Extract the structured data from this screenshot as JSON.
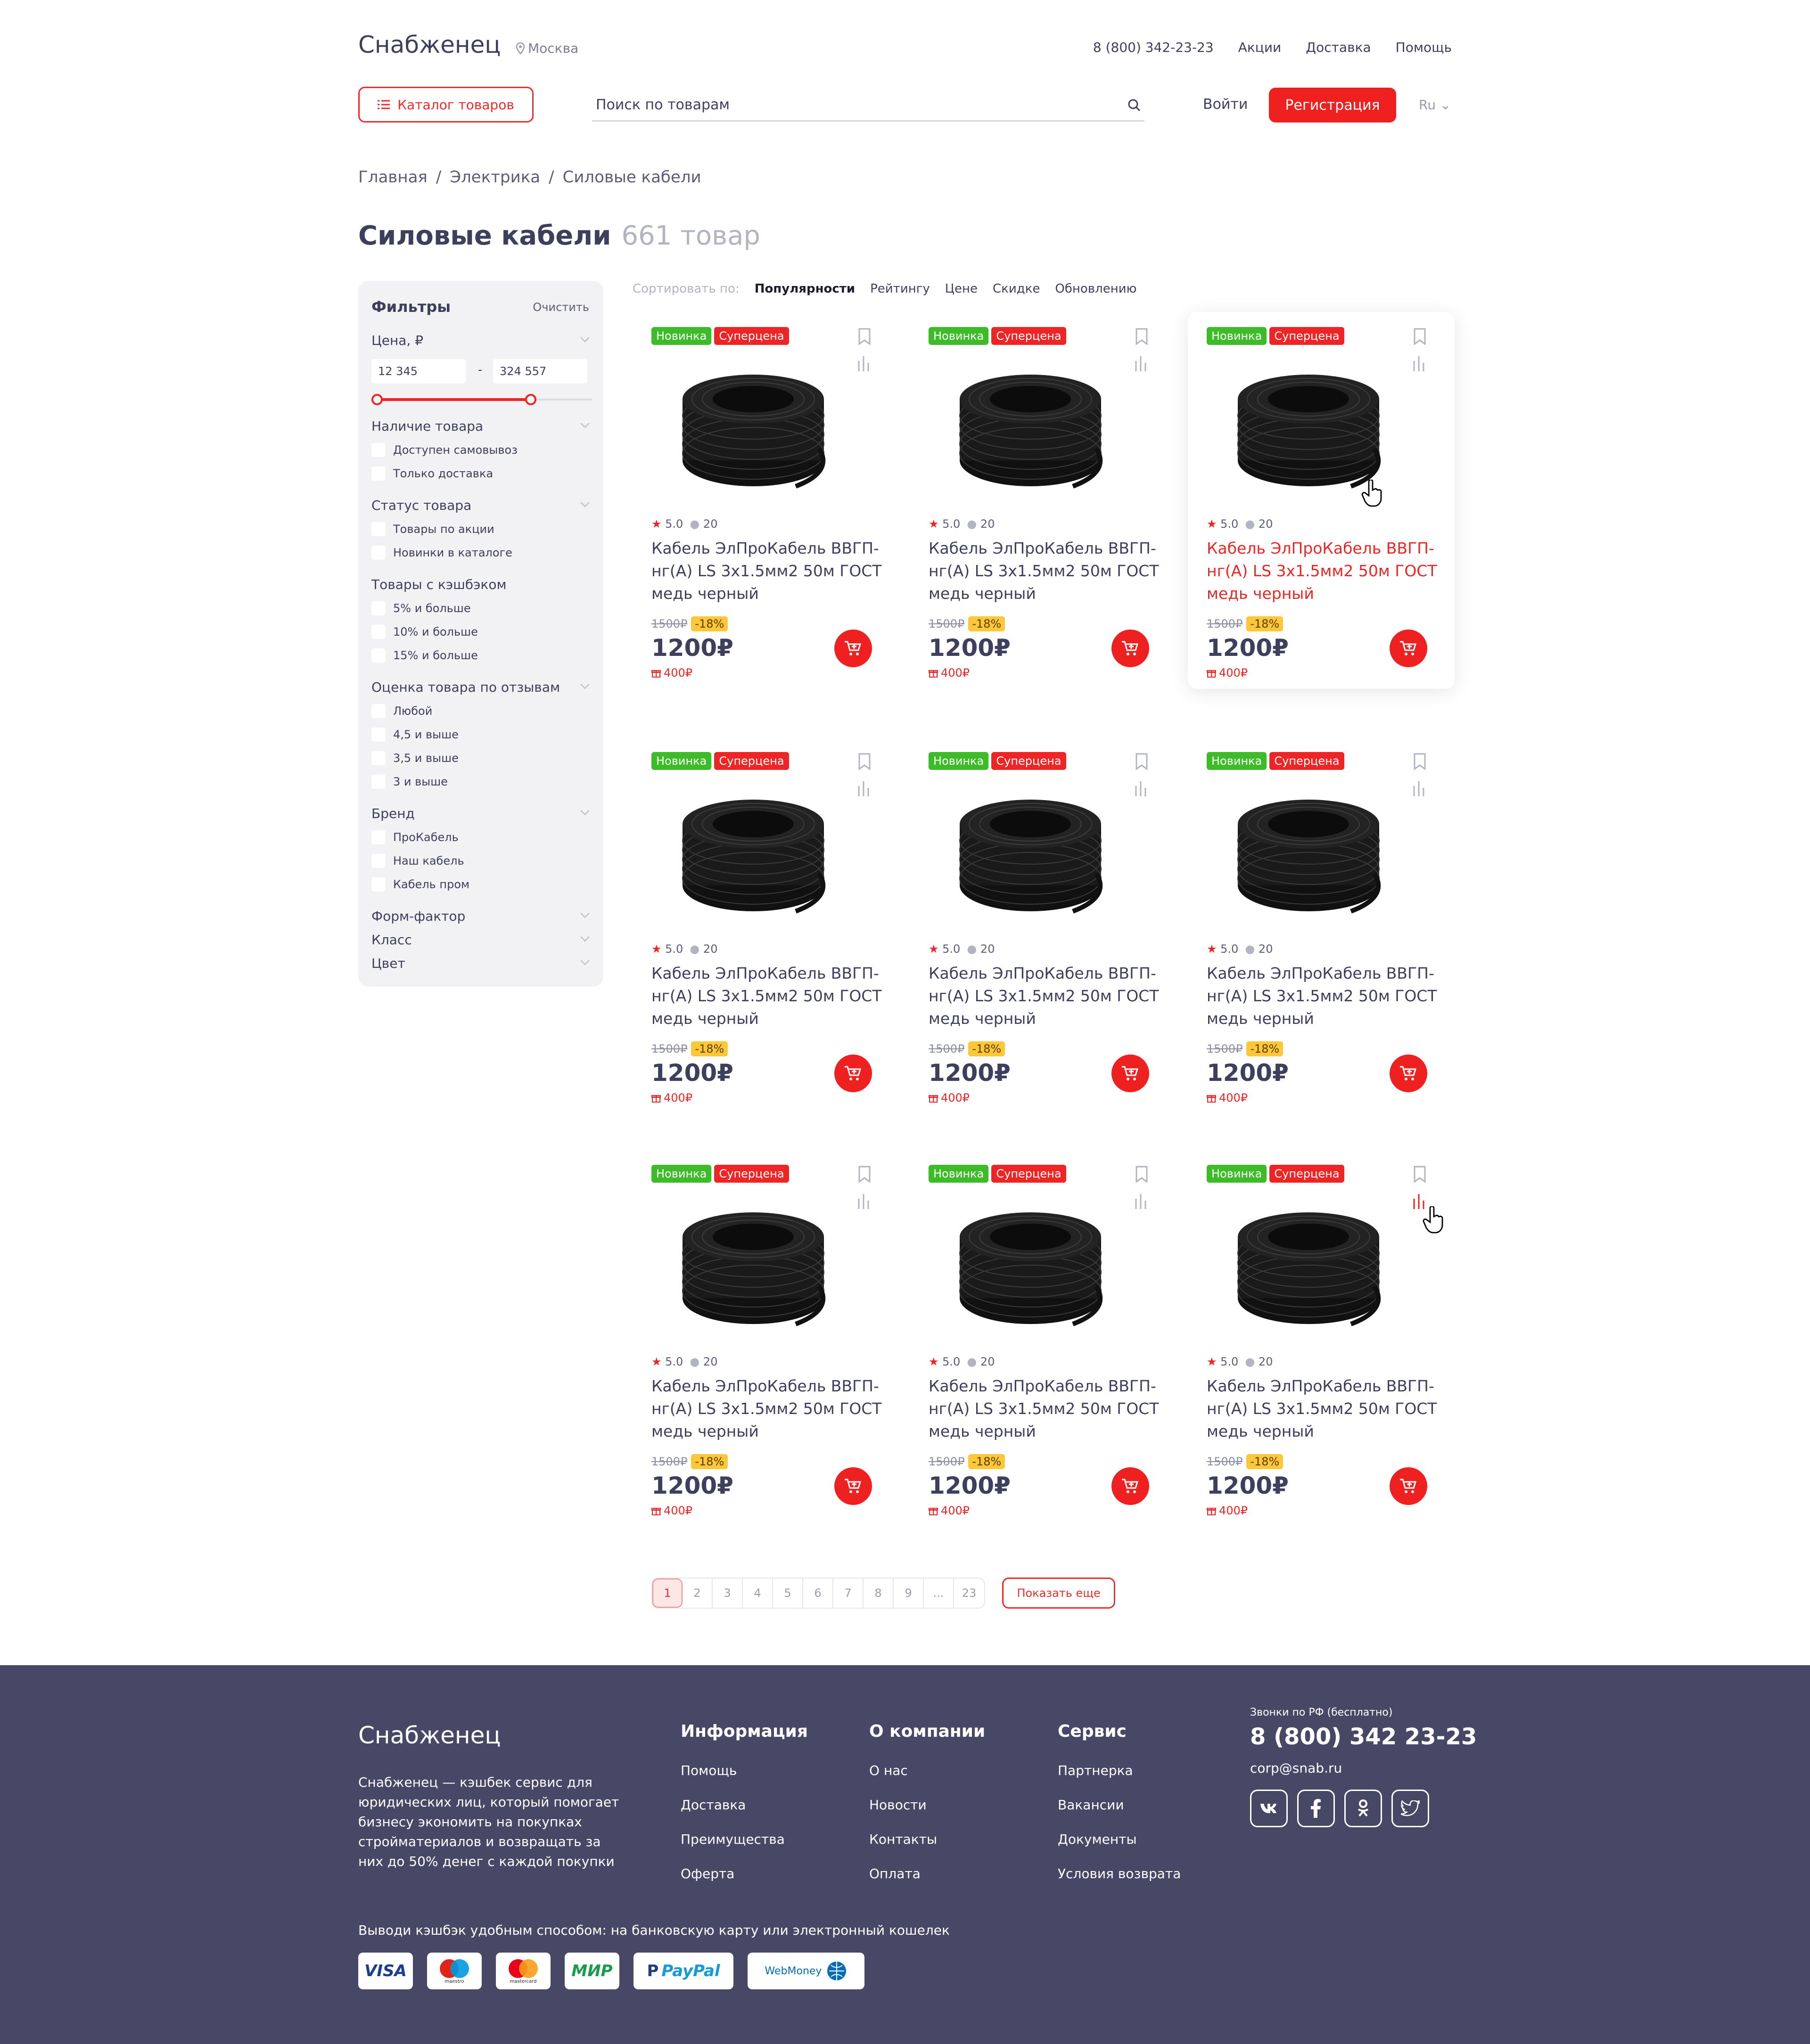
{
  "header": {
    "logo": "Снабженец",
    "city": "Москва",
    "phone": "8 (800) 342-23-23",
    "nav": [
      "Акции",
      "Доставка",
      "Помощь"
    ],
    "catalog_label": "Каталог товаров",
    "search_placeholder": "Поиск по товарам",
    "login_label": "Войти",
    "register_label": "Регистрация",
    "lang": "Ru"
  },
  "breadcrumbs": [
    "Главная",
    "Электрика",
    "Силовые кабели"
  ],
  "breadcrumb_sep": "/",
  "page": {
    "title": "Силовые кабели",
    "count": "661 товар"
  },
  "filters": {
    "title": "Фильтры",
    "clear": "Очистить",
    "price": {
      "label": "Цена, ₽",
      "min": "12 345",
      "max": "324 557",
      "dash": "-"
    },
    "groups": [
      {
        "label": "Наличие товара",
        "options": [
          "Доступен самовывоз",
          "Только доставка"
        ]
      },
      {
        "label": "Статус товара",
        "options": [
          "Товары по акции",
          "Новинки в каталоге"
        ]
      },
      {
        "label": "Товары с кэшбэком",
        "options": [
          "5% и больше",
          "10% и больше",
          "15% и больше"
        ]
      },
      {
        "label": "Оценка товара по отзывам",
        "options": [
          "Любой",
          "4,5 и выше",
          "3,5 и выше",
          "3 и выше"
        ]
      },
      {
        "label": "Бренд",
        "options": [
          "ПроКабель",
          "Наш кабель",
          "Кабель пром"
        ]
      }
    ],
    "collapsed": [
      "Форм-фактор",
      "Класс",
      "Цвет"
    ]
  },
  "sort": {
    "label": "Сортировать по:",
    "options": [
      "Популярности",
      "Рейтингу",
      "Цене",
      "Скидке",
      "Обновлению"
    ],
    "active": "Популярности"
  },
  "product": {
    "badge_new": "Новинка",
    "badge_super": "Суперцена",
    "rating": "5.0",
    "reviews": "20",
    "title": "Кабель ЭлПроКабель ВВГП-нг(А) LS 3х1.5мм2 50м ГОСТ медь черный",
    "old_price": "1500₽",
    "discount": "-18%",
    "price": "1200₽",
    "cashback": "400₽"
  },
  "product_count_shown": 9,
  "pagination": {
    "pages": [
      "1",
      "2",
      "3",
      "4",
      "5",
      "6",
      "7",
      "8",
      "9",
      "...",
      "23"
    ],
    "current": "1",
    "more_label": "Показать еще"
  },
  "footer": {
    "logo": "Снабженец",
    "description": "Снабженец — кэшбек сервис для юридических лиц, который помогает бизнесу экономить на покупках стройматериалов и возвращать за них до 50% денег с каждой покупки",
    "columns": [
      {
        "title": "Информация",
        "links": [
          "Помощь",
          "Доставка",
          "Преимущества",
          "Оферта"
        ]
      },
      {
        "title": "О компании",
        "links": [
          "О нас",
          "Новости",
          "Контакты",
          "Оплата"
        ]
      },
      {
        "title": "Сервис",
        "links": [
          "Партнерка",
          "Вакансии",
          "Документы",
          "Условия возврата"
        ]
      }
    ],
    "phone_note": "Звонки по РФ (бесплатно)",
    "phone": "8 (800) 342 23-23",
    "email": "corp@snab.ru",
    "socials": [
      "vk-icon",
      "facebook-icon",
      "odnoklassniki-icon",
      "twitter-icon"
    ],
    "payout_text": "Выводи кэшбэк удобным способом: на банковскую карту или электронный кошелек",
    "payments": [
      "VISA",
      "maestro",
      "mastercard",
      "МИР",
      "PayPal",
      "WebMoney"
    ]
  },
  "colors": {
    "accent": "#ef2020",
    "footer_bg": "#474866",
    "new_badge": "#3dbb28",
    "discount_badge": "#fdc73a",
    "text": "#3d3f5c"
  }
}
